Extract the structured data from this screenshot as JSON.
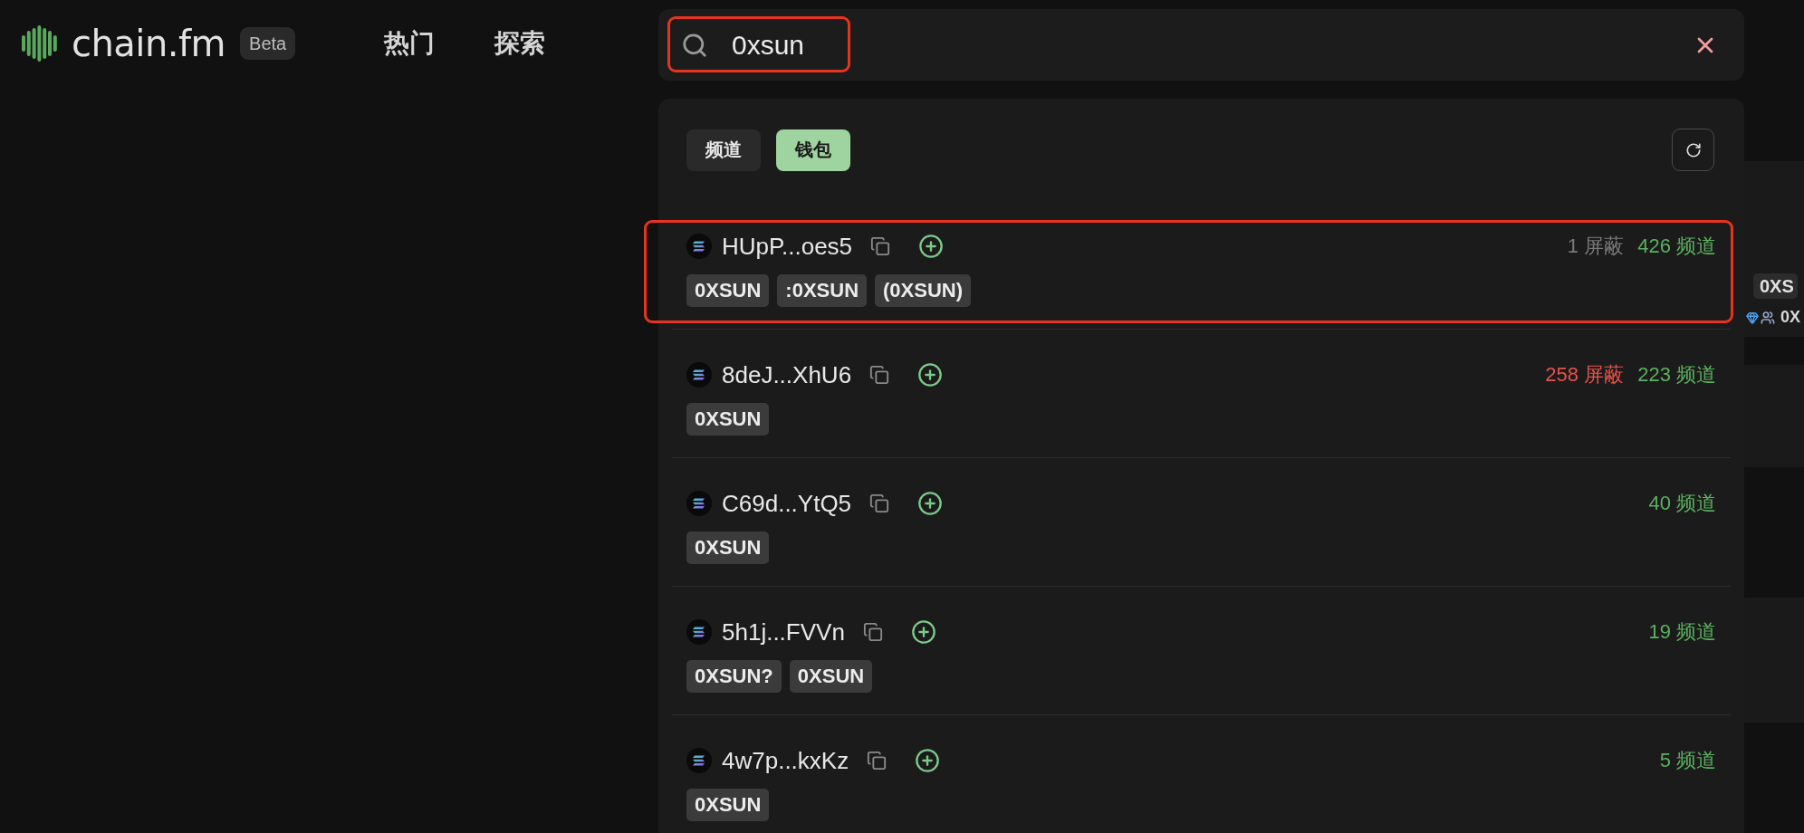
{
  "header": {
    "logo": "chain.fm",
    "badge": "Beta",
    "nav": [
      {
        "label": "热门"
      },
      {
        "label": "探索"
      }
    ]
  },
  "search": {
    "value": "0xsun",
    "highlighted": true
  },
  "results": {
    "tabs": [
      {
        "label": "频道",
        "selected": false
      },
      {
        "label": "钱包",
        "selected": true
      }
    ],
    "wallets": [
      {
        "address": "HUpP...oes5",
        "blocked": "1 屏蔽",
        "blocked_flagged": false,
        "channels": "426 频道",
        "tags": [
          "0XSUN",
          ":0XSUN",
          "(0XSUN)"
        ],
        "highlighted": true
      },
      {
        "address": "8deJ...XhU6",
        "blocked": "258 屏蔽",
        "blocked_flagged": true,
        "channels": "223 频道",
        "tags": [
          "0XSUN"
        ],
        "highlighted": false
      },
      {
        "address": "C69d...YtQ5",
        "channels": "40 频道",
        "tags": [
          "0XSUN"
        ],
        "highlighted": false
      },
      {
        "address": "5h1j...FVVn",
        "channels": "19 频道",
        "tags": [
          "0XSUN?",
          "0XSUN"
        ],
        "highlighted": false
      },
      {
        "address": "4w7p...kxKz",
        "channels": "5 频道",
        "tags": [
          "0XSUN"
        ],
        "highlighted": false
      }
    ]
  },
  "background_card": {
    "tag": "0XS",
    "label": "0X"
  }
}
